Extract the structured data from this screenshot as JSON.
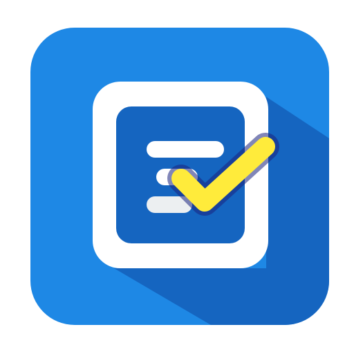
{
  "app_icon": {
    "icon": "checklist-icon",
    "colors": {
      "tile": "#1e88e5",
      "tile_shadow": "#1565c0",
      "frame": "#ffffff",
      "document": "#1565c0",
      "line_primary": "#ffffff",
      "line_secondary": "#eceff1",
      "check": "#ffeb3b",
      "check_outline": "#1a237e"
    }
  }
}
